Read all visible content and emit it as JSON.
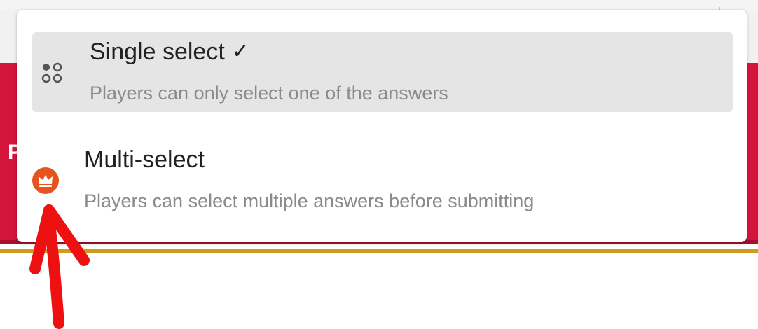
{
  "dropdown": {
    "options": [
      {
        "title": "Single select",
        "description": "Players can only select one of the answers",
        "selected": true,
        "icon": "dots-grid-icon",
        "check_icon": "checkmark-icon"
      },
      {
        "title": "Multi-select",
        "description": "Players can select multiple answers before submitting",
        "selected": false,
        "icon": "crown-premium-icon"
      }
    ]
  },
  "background": {
    "partial_letter": "P"
  },
  "annotation": {
    "type": "red-arrow",
    "points_to": "crown-premium-icon"
  },
  "colors": {
    "selected_bg": "#e5e5e5",
    "crown_badge": "#e8521c",
    "brand_red": "#d4163c",
    "gold_line": "#d09a1a",
    "annotation_red": "#ee1111"
  }
}
